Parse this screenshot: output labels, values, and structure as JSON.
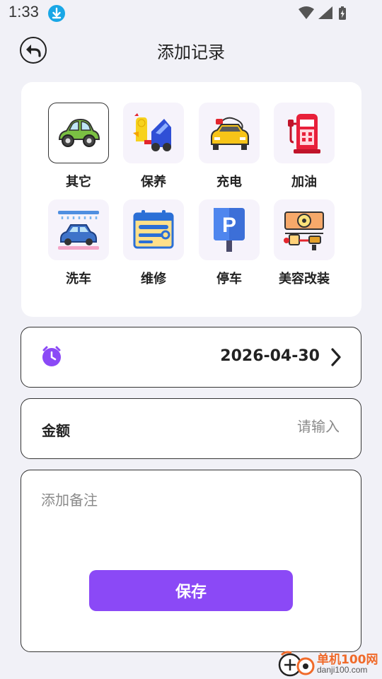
{
  "status_bar": {
    "time": "1:33"
  },
  "header": {
    "title": "添加记录"
  },
  "categories": [
    {
      "label": "其它",
      "icon": "car-icon",
      "selected": true
    },
    {
      "label": "保养",
      "icon": "car-maintenance-icon",
      "selected": false
    },
    {
      "label": "充电",
      "icon": "ev-charging-icon",
      "selected": false
    },
    {
      "label": "加油",
      "icon": "fuel-pump-icon",
      "selected": false
    },
    {
      "label": "洗车",
      "icon": "car-wash-icon",
      "selected": false
    },
    {
      "label": "维修",
      "icon": "repair-tools-icon",
      "selected": false
    },
    {
      "label": "停车",
      "icon": "parking-sign-icon",
      "selected": false
    },
    {
      "label": "美容改装",
      "icon": "car-detailing-icon",
      "selected": false
    }
  ],
  "date": {
    "value": "2026-04-30"
  },
  "amount": {
    "label": "金额",
    "placeholder": "请输入",
    "value": ""
  },
  "note": {
    "placeholder": "添加备注",
    "value": ""
  },
  "save_button": {
    "label": "保存"
  },
  "watermark": {
    "brand": "单机100网",
    "url": "danji100.com"
  },
  "colors": {
    "accent": "#8b49f6",
    "background": "#f1f1f7"
  }
}
